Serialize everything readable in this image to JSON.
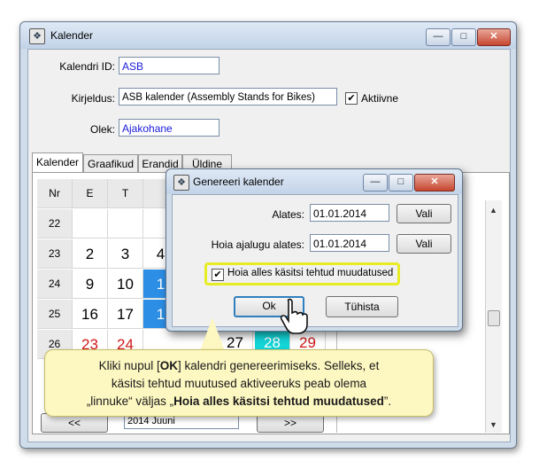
{
  "window": {
    "title": "Kalender",
    "min_glyph": "—",
    "max_glyph": "□",
    "close_glyph": "✕"
  },
  "form": {
    "id_label": "Kalendri ID:",
    "id_value": "ASB",
    "desc_label": "Kirjeldus:",
    "desc_value": "ASB kalender (Assembly Stands for Bikes)",
    "active_label": "Aktiivne",
    "active_checked": true,
    "status_label": "Olek:",
    "status_value": "Ajakohane"
  },
  "tabs": [
    "Kalender",
    "Graafikud",
    "Erandid",
    "Üldine"
  ],
  "calendar": {
    "headers": [
      "Nr",
      "E",
      "T",
      ""
    ],
    "rows": [
      {
        "wk": "22",
        "days": [
          "",
          "",
          ""
        ]
      },
      {
        "wk": "23",
        "days": [
          "2",
          "3",
          "4"
        ]
      },
      {
        "wk": "24",
        "days": [
          "9",
          "10",
          "1"
        ]
      },
      {
        "wk": "25",
        "days": [
          "16",
          "17",
          "1"
        ]
      },
      {
        "wk": "26",
        "days": [
          "23",
          "24",
          ""
        ]
      }
    ],
    "extra_days": [
      "27",
      "28",
      "29"
    ],
    "nav_prev": "<<",
    "nav_next": ">>",
    "month_value": "2014 Juuni"
  },
  "dialog": {
    "title": "Genereeri kalender",
    "from_label": "Alates:",
    "from_value": "01.01.2014",
    "from_btn": "Vali",
    "keep_label": "Hoia ajalugu alates:",
    "keep_value": "01.01.2014",
    "keep_btn": "Vali",
    "check_label": "Hoia alles käsitsi tehtud muudatused",
    "check_checked": true,
    "ok": "Ok",
    "cancel": "Tühista"
  },
  "callout": {
    "line1": "Kliki nupul [OK] kalendri genereerimiseks. Selleks, et",
    "line2": "käsitsi tehtud muutused aktiveeruks peab olema",
    "line3a": "„linnuke“ väljas „",
    "line3b": "Hoia alles käsitsi tehtud muudatused",
    "line3c": "”."
  },
  "colors": {
    "highlight_day": "#2c8fe5",
    "today": "#14d5d8",
    "weekend": "#d01818",
    "callout_bg": "#fdf7c1",
    "focus_ring": "#e8ec24"
  }
}
